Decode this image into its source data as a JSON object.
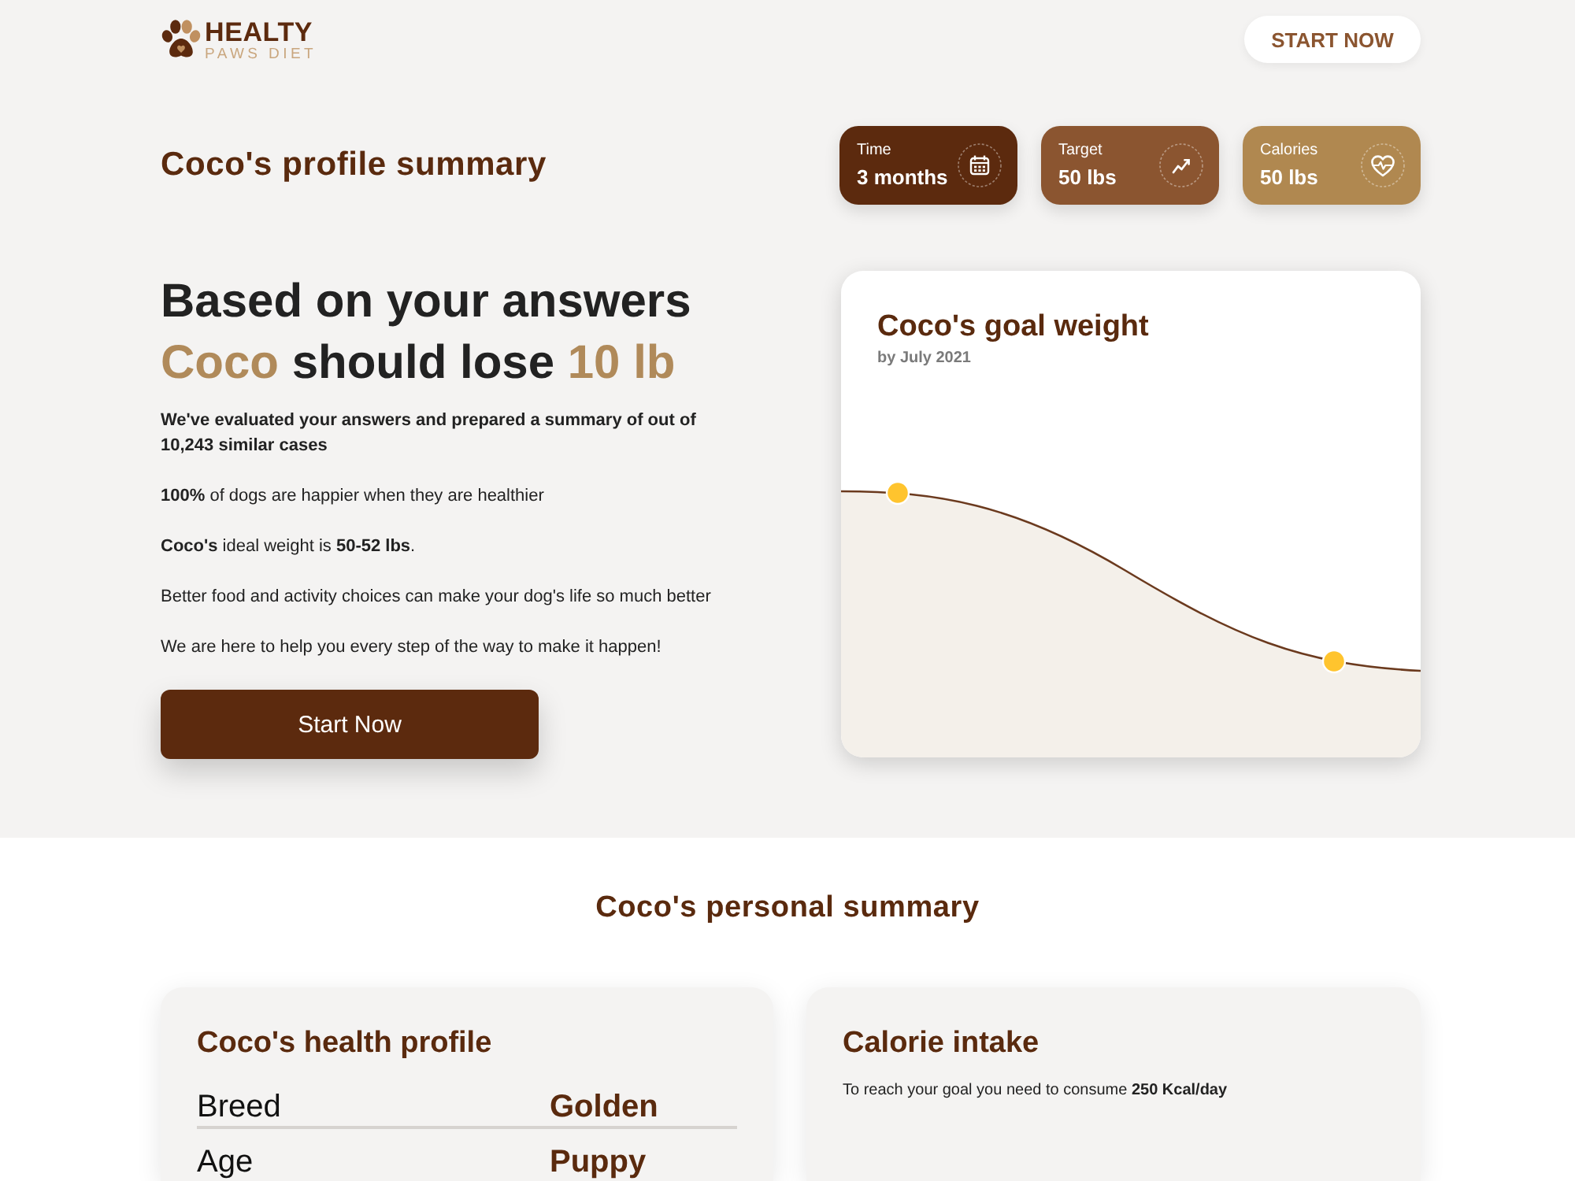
{
  "header": {
    "brand": "HEALTY",
    "tagline": "PAWS DIET",
    "cta": "START NOW"
  },
  "profile": {
    "title": "Coco's profile summary",
    "stats": [
      {
        "label": "Time",
        "value": "3 months",
        "color": "#5c2a0e"
      },
      {
        "label": "Target",
        "value": "50 lbs",
        "color": "#8b5530"
      },
      {
        "label": "Calories",
        "value": "50 lbs",
        "color": "#b08850"
      }
    ]
  },
  "hero": {
    "headline": {
      "line_1": "Based on your answers",
      "line_2": [
        {
          "text": "Coco",
          "accent": true
        },
        {
          "text": " should lose ",
          "accent": false
        },
        {
          "text": "10 lb",
          "accent": true
        }
      ]
    },
    "lead": "We've evaluated your answers and prepared a summary of out of 10,243 similar cases",
    "points": [
      "**100%** of dogs are happier when they are healthier",
      "**Coco's** ideal weight is **50-52 lbs**.",
      "Better food and activity choices can make your dog's life so much better",
      "We are here to help you every step of the way to make it happen!"
    ],
    "button": "Start Now"
  },
  "goal_chart": {
    "title": "Coco's goal weight",
    "subtitle": "by July 2021"
  },
  "personal_summary": {
    "title": "Coco's personal summary",
    "health_profile": {
      "title": "Coco's health profile",
      "rows": [
        {
          "label": "Breed",
          "value": "Golden"
        },
        {
          "label": "Age",
          "value": "Puppy"
        }
      ]
    },
    "calorie_intake": {
      "title": "Calorie intake",
      "text": "To reach your goal you need to consume **250 Kcal/day**"
    }
  }
}
